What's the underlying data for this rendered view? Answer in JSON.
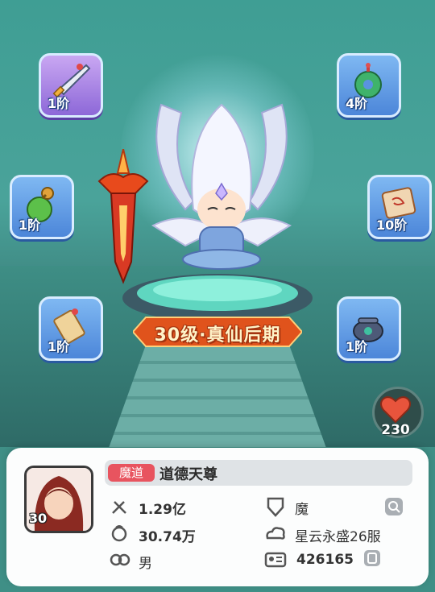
{
  "equipment_slots": [
    {
      "id": "sword",
      "level": "1阶",
      "frame": "purple",
      "icon": "sword-icon"
    },
    {
      "id": "jade",
      "level": "4阶",
      "frame": "blue",
      "icon": "jade-pendant-icon"
    },
    {
      "id": "gourd",
      "level": "1阶",
      "frame": "blue",
      "icon": "gourd-icon"
    },
    {
      "id": "scroll",
      "level": "10阶",
      "frame": "blue",
      "icon": "scroll-icon"
    },
    {
      "id": "talisman",
      "level": "1阶",
      "frame": "blue",
      "icon": "talisman-icon"
    },
    {
      "id": "cauldron",
      "level": "1阶",
      "frame": "blue",
      "icon": "cauldron-icon"
    }
  ],
  "realm_banner": "30级·真仙后期",
  "likes": {
    "count": "230",
    "icon": "heart-icon"
  },
  "profile": {
    "avatar_level": "30",
    "faction_tag": "魔道",
    "name": "道德天尊",
    "power": "1.29亿",
    "faction": "魔",
    "hp": "30.74万",
    "server": "星云永盛26服",
    "gender": "男",
    "id": "426165"
  },
  "colors": {
    "tag_red": "#e8545f",
    "slot_blue": "#5a93e0",
    "slot_purple": "#9a78de",
    "banner_orange": "#e0531c"
  }
}
